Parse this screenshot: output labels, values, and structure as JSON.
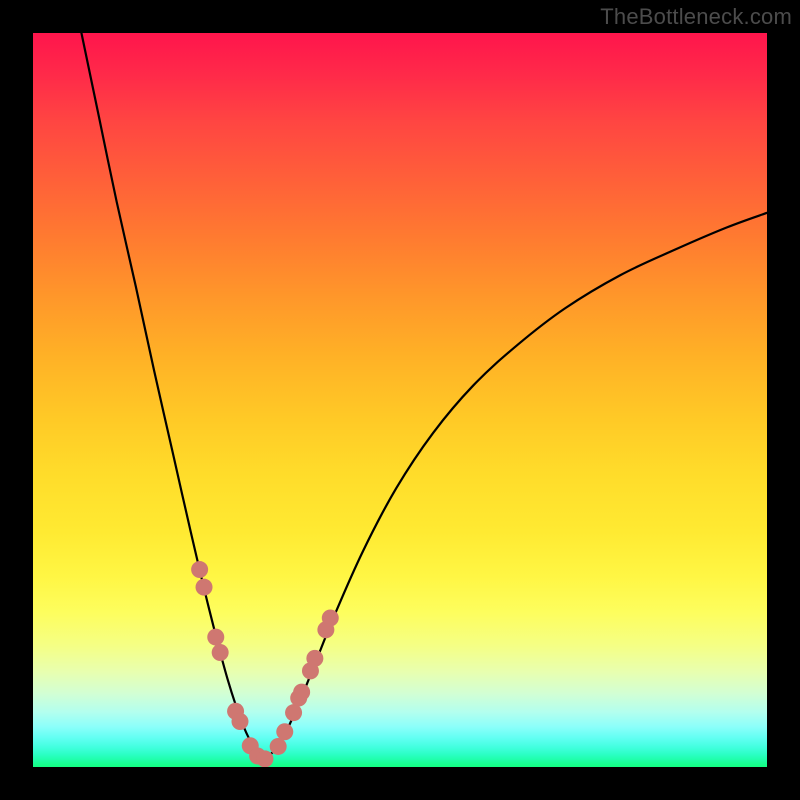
{
  "watermark": "TheBottleneck.com",
  "chart_data": {
    "type": "line",
    "title": "",
    "xlabel": "",
    "ylabel": "",
    "xlim": [
      0,
      1
    ],
    "ylim": [
      0,
      1
    ],
    "note": "V-shaped bottleneck curve. Axes unlabeled; x/y are normalized 0–1 across the plot area. Curve dips to near-zero at x≈0.315 then rises asymptotically toward ~0.75. Dots are clustered near the trough.",
    "series": [
      {
        "name": "left-branch",
        "x": [
          0.066,
          0.09,
          0.114,
          0.14,
          0.165,
          0.19,
          0.215,
          0.24,
          0.265,
          0.287,
          0.305,
          0.315
        ],
        "values": [
          1.0,
          0.885,
          0.77,
          0.655,
          0.54,
          0.43,
          0.32,
          0.215,
          0.12,
          0.055,
          0.02,
          0.01
        ]
      },
      {
        "name": "right-branch",
        "x": [
          0.315,
          0.335,
          0.355,
          0.38,
          0.41,
          0.45,
          0.495,
          0.545,
          0.6,
          0.66,
          0.725,
          0.8,
          0.875,
          0.945,
          1.0
        ],
        "values": [
          0.01,
          0.03,
          0.07,
          0.13,
          0.205,
          0.295,
          0.38,
          0.455,
          0.52,
          0.575,
          0.625,
          0.67,
          0.705,
          0.735,
          0.755
        ]
      }
    ],
    "dots": {
      "x": [
        0.227,
        0.233,
        0.249,
        0.255,
        0.276,
        0.282,
        0.296,
        0.306,
        0.316,
        0.334,
        0.343,
        0.355,
        0.362,
        0.366,
        0.378,
        0.384,
        0.399,
        0.405
      ],
      "values": [
        0.269,
        0.245,
        0.177,
        0.156,
        0.076,
        0.062,
        0.029,
        0.015,
        0.011,
        0.028,
        0.048,
        0.074,
        0.094,
        0.102,
        0.131,
        0.148,
        0.187,
        0.203
      ]
    },
    "dot_radius_px": 8.5,
    "colors": {
      "curve": "#000000",
      "dots": "#cf7771",
      "background_top": "#ff154c",
      "background_bottom": "#14ff84"
    }
  }
}
